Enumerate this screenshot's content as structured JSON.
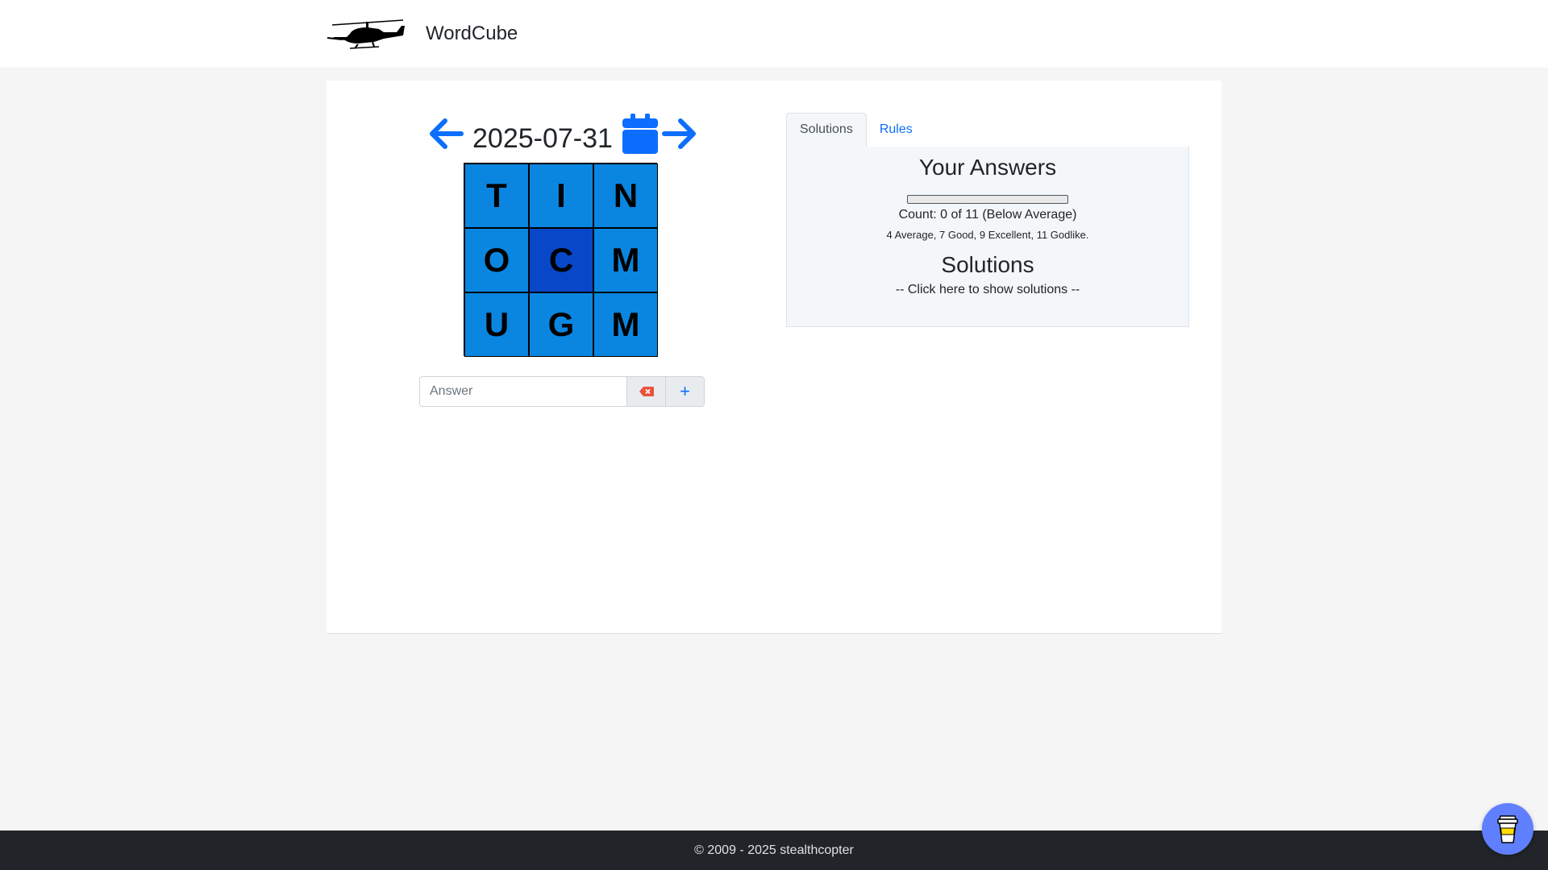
{
  "header": {
    "brand_name": "WordCube",
    "logo_icon": "helicopter-icon"
  },
  "puzzle": {
    "date": "2025-07-31",
    "prev_icon": "arrow-left-icon",
    "next_icon": "arrow-right-icon",
    "calendar_icon": "calendar-icon",
    "grid": [
      [
        "T",
        "I",
        "N"
      ],
      [
        "O",
        "C",
        "M"
      ],
      [
        "U",
        "G",
        "M"
      ]
    ],
    "answer_placeholder": "Answer",
    "answer_value": "",
    "clear_icon": "backspace-icon",
    "add_label": "+"
  },
  "tabs": [
    {
      "label": "Solutions",
      "active": true
    },
    {
      "label": "Rules",
      "active": false
    }
  ],
  "solutions_panel": {
    "answers_heading": "Your Answers",
    "progress": 0,
    "count_text": "Count: 0 of 11 (Below Average)",
    "thresholds": "4 Average, 7 Good, 9 Excellent, 11 Godlike.",
    "solutions_heading": "Solutions",
    "show_solutions": "-- Click here to show solutions --"
  },
  "footer": {
    "text": "© 2009 - 2025 stealthcopter"
  },
  "colors": {
    "accent": "#0d6efd",
    "cell": "#0a86e0",
    "cell_center": "#0747c8",
    "coffee_button": "#5f7fff"
  },
  "coffee_icon": "coffee-cup-icon"
}
